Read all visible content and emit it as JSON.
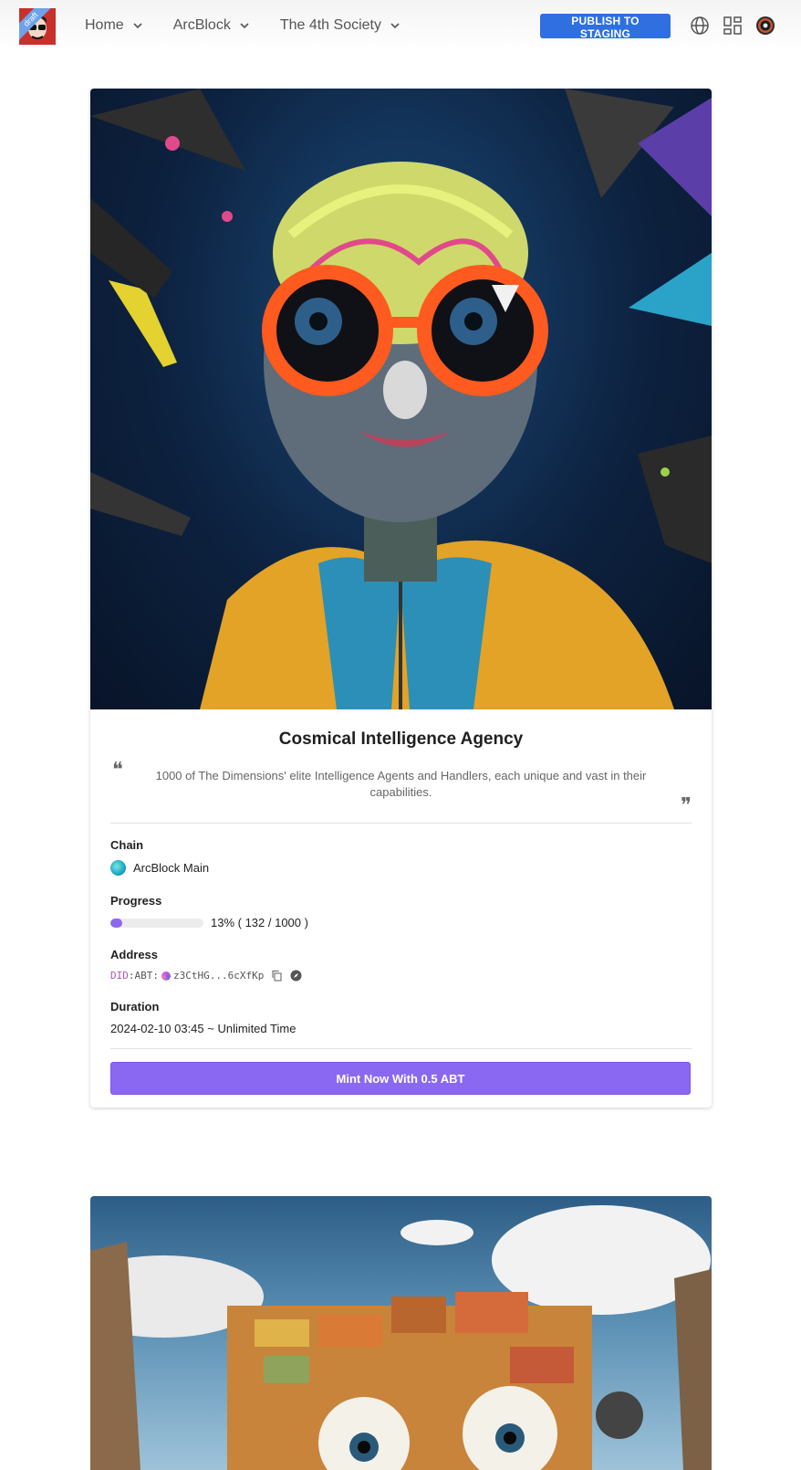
{
  "header": {
    "logo_badge": "draft",
    "nav": [
      {
        "label": "Home"
      },
      {
        "label": "ArcBlock"
      },
      {
        "label": "The 4th Society"
      }
    ],
    "publish_label": "PUBLISH TO STAGING",
    "icons": [
      "globe-icon",
      "dashboard-icon",
      "user-avatar"
    ]
  },
  "card": {
    "title": "Cosmical Intelligence Agency",
    "description": "1000 of The Dimensions' elite Intelligence Agents and Handlers, each unique and vast in their capabilities.",
    "chain_label": "Chain",
    "chain_value": "ArcBlock Main",
    "progress_label": "Progress",
    "progress_text": "13% ( 132 / 1000 )",
    "progress_fraction": 0.13,
    "address_label": "Address",
    "address_prefix": "DID",
    "address_mid": ":ABT:",
    "address_value": "z3CtHG...6cXfKp",
    "duration_label": "Duration",
    "duration_value": "2024-02-10 03:45 ~ Unlimited Time",
    "mint_label": "Mint Now With 0.5 ABT"
  },
  "colors": {
    "accent_purple": "#8b68f1",
    "publish_blue": "#2f6fe0",
    "logo_red": "#c8302c"
  }
}
